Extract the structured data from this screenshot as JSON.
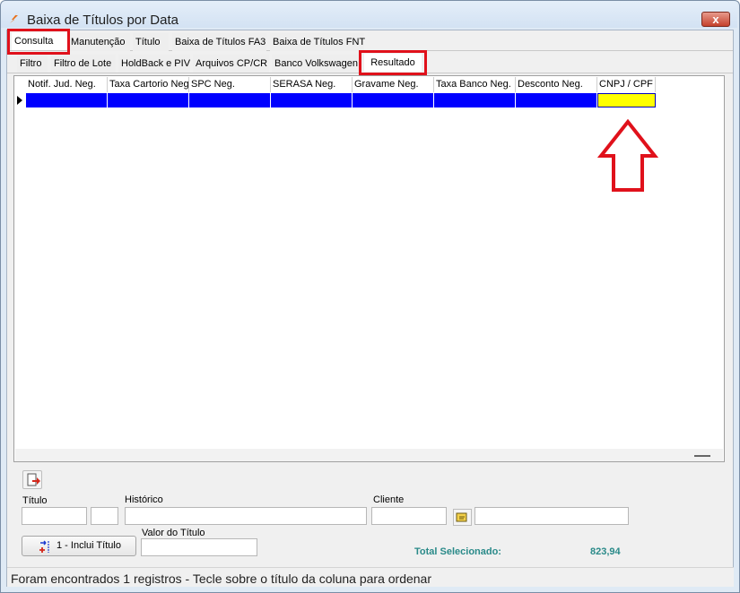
{
  "window": {
    "title": "Baixa de Títulos por Data",
    "close_glyph": "x"
  },
  "main_tabs": [
    {
      "label": "Consulta",
      "selected": true,
      "highlighted": true
    },
    {
      "label": "Manutenção",
      "selected": false
    },
    {
      "label": "Título",
      "selected": false
    },
    {
      "label": "Baixa de Títulos FA3",
      "selected": false
    },
    {
      "label": "Baixa de Títulos FNT",
      "selected": false
    }
  ],
  "sub_tabs": [
    {
      "label": "Filtro",
      "selected": false
    },
    {
      "label": "Filtro de Lote",
      "selected": false
    },
    {
      "label": "HoldBack e PIV",
      "selected": false
    },
    {
      "label": "Arquivos CP/CR",
      "selected": false
    },
    {
      "label": "Banco Volkswagen",
      "selected": false
    },
    {
      "label": "Resultado",
      "selected": true,
      "highlighted": true
    }
  ],
  "grid": {
    "columns": [
      "Notif. Jud. Neg.",
      "Taxa Cartorio Neg",
      "SPC Neg.",
      "SERASA Neg.",
      "Gravame Neg.",
      "Taxa Banco Neg.",
      "Desconto Neg.",
      "CNPJ / CPF"
    ],
    "rows": [
      [
        "",
        "",
        "",
        "",
        "",
        "",
        "",
        ""
      ]
    ],
    "row_color": "#0000ff",
    "active_cell_color": "#ffff00"
  },
  "annotations": {
    "highlight_color": "#e0111b",
    "arrow": "up-arrow pointing to CNPJ / CPF column"
  },
  "form": {
    "titulo_label": "Título",
    "historico_label": "Histórico",
    "cliente_label": "Cliente",
    "valor_label": "Valor do Título",
    "titulo_value": "",
    "titulo_suffix_value": "",
    "historico_value": "",
    "cliente_code_value": "",
    "cliente_name_value": "",
    "valor_value": "",
    "add_button_label": "1 - Inclui Título",
    "total_label": "Total Selecionado:",
    "total_value": "823,94",
    "total_color": "#2a8a89"
  },
  "status_bar": {
    "text": "Foram encontrados 1 registros  - Tecle sobre o título da coluna para ordenar"
  },
  "icons": [
    "app-logo-icon",
    "close-icon",
    "export-icon",
    "lookup-icon",
    "add-item-icon"
  ]
}
